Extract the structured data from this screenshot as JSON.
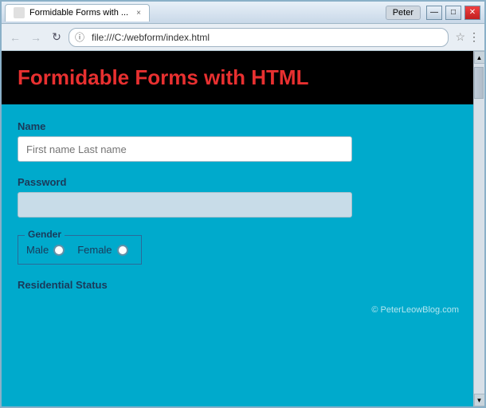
{
  "window": {
    "user_label": "Peter",
    "min_btn": "—",
    "max_btn": "□",
    "close_btn": "✕"
  },
  "tab": {
    "label": "Formidable Forms with ...",
    "close": "×"
  },
  "nav": {
    "back": "←",
    "forward": "→",
    "refresh": "↻",
    "address": "file:///C:/webform/index.html",
    "star": "☆",
    "menu": "⋮"
  },
  "page": {
    "title": "Formidable Forms with HTML",
    "name_label": "Name",
    "name_placeholder": "First name Last name",
    "password_label": "Password",
    "gender_legend": "Gender",
    "male_label": "Male",
    "female_label": "Female",
    "residential_label": "Residential Status",
    "copyright": "© PeterLeowBlog.com"
  },
  "colors": {
    "page_bg": "#00aacc",
    "title_color": "#e83030",
    "header_bg": "#000000"
  }
}
